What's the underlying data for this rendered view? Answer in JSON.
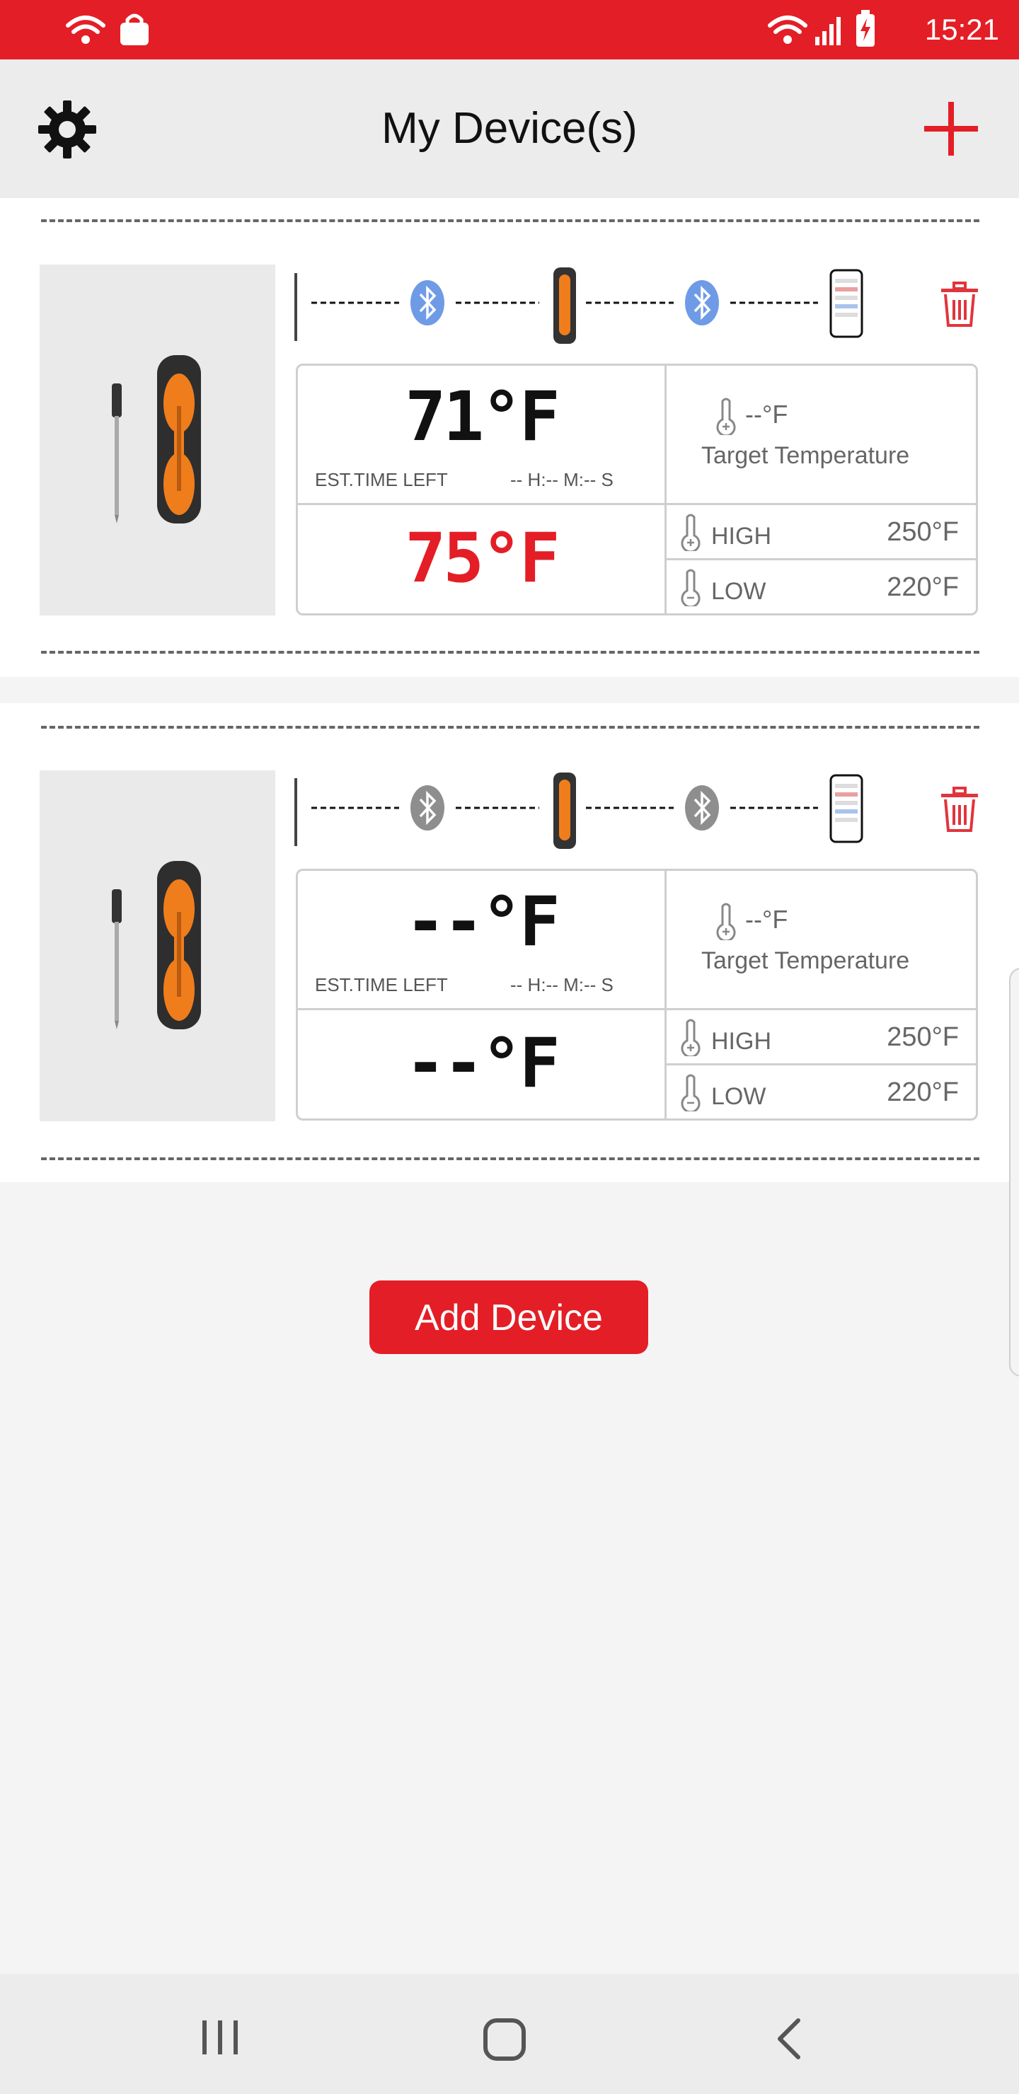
{
  "status_bar": {
    "time": "15:21",
    "icons": [
      "wifi-call-icon",
      "shopping-bag-icon",
      "wifi-icon",
      "signal-icon",
      "battery-charging-icon"
    ]
  },
  "header": {
    "title": "My Device(s)",
    "left_icon": "gear-icon",
    "right_icon": "plus-icon"
  },
  "devices": [
    {
      "connection": {
        "probe_to_booster": "connected",
        "booster_to_phone": "connected"
      },
      "current_temp": "71°F",
      "ambient_temp": "75°F",
      "est_time_label": "EST.TIME LEFT",
      "est_time_value": "-- H:-- M:-- S",
      "target_value": "--°F",
      "target_label": "Target Temperature",
      "high_label": "HIGH",
      "high_value": "250°F",
      "low_label": "LOW",
      "low_value": "220°F"
    },
    {
      "connection": {
        "probe_to_booster": "disconnected",
        "booster_to_phone": "disconnected"
      },
      "current_temp": "--°F",
      "ambient_temp": "--°F",
      "est_time_label": "EST.TIME LEFT",
      "est_time_value": "-- H:-- M:-- S",
      "target_value": "--°F",
      "target_label": "Target Temperature",
      "high_label": "HIGH",
      "high_value": "250°F",
      "low_label": "LOW",
      "low_value": "220°F"
    }
  ],
  "add_device_label": "Add Device",
  "colors": {
    "brand_red": "#e41e26",
    "bluetooth_connected": "#6f9be6",
    "bluetooth_disconnected": "#8e8e8e",
    "ambient_temp_red": "#e41e26"
  },
  "nav_bar": {
    "icons": [
      "recents-icon",
      "home-icon",
      "back-icon"
    ]
  }
}
